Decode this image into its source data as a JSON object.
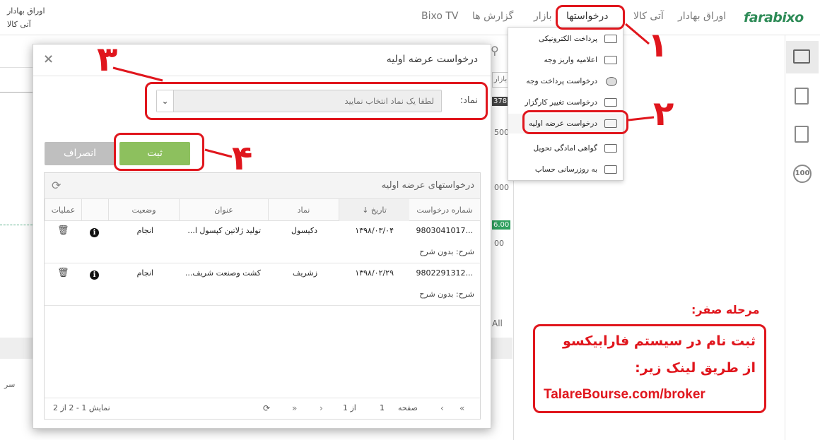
{
  "header": {
    "logo_text": "farabixo",
    "nav": [
      "اوراق بهادار",
      "آتی کالا",
      "درخواستها",
      "بازار",
      "گزارش ها",
      "Bixo TV"
    ],
    "top_left_line1": "اوراق بهادار",
    "top_left_line2": "آتی کالا"
  },
  "menu": {
    "items": [
      {
        "label": "پرداخت الکترونیکی",
        "icon": "card-icon"
      },
      {
        "label": "اعلامیه واریز وجه",
        "icon": "receipt-icon"
      },
      {
        "label": "درخواست پرداخت وجه",
        "icon": "coins-icon"
      },
      {
        "label": "درخواست تغییر کارگزار ناظر",
        "icon": "form-icon"
      },
      {
        "label": "درخواست عرضه اولیه",
        "icon": "form-icon"
      },
      {
        "label": "گواهی امادگی تحویل",
        "icon": "sign-icon"
      },
      {
        "label": "به روزرسانی حساب",
        "icon": "sign-icon"
      }
    ]
  },
  "background": {
    "cell1": "بازار",
    "val1": "378.0",
    "val2": "500",
    "val3": "000",
    "val4": "6.00",
    "val5": "00",
    "val6": "All",
    "col_hint": "سر"
  },
  "modal": {
    "title": "درخواست عرضه اولیه",
    "close": "×",
    "field_label": "نماد:",
    "select_placeholder": "لطفا یک نماد انتخاب نمایید",
    "save_label": "ثبت",
    "cancel_label": "انصراف",
    "grid_title": "درخواستهای عرضه اولیه",
    "columns": [
      "شماره درخواست",
      "تاریخ",
      "نماد",
      "عنوان",
      "وضعیت",
      "",
      "عملیات"
    ],
    "rows": [
      {
        "number": "9803041017...",
        "date": "۱۳۹۸/۰۳/۰۴",
        "symbol": "دکیسول",
        "title": "تولید ژلاتین کپسول ا...",
        "status": "انجام",
        "desc": "شرح: بدون شرح"
      },
      {
        "number": "9802291312...",
        "date": "۱۳۹۸/۰۲/۲۹",
        "symbol": "زشریف",
        "title": "کشت وصنعت شریف...",
        "status": "انجام",
        "desc": "شرح: بدون شرح"
      }
    ],
    "pager": {
      "page_label": "صفحه",
      "page_value": "1",
      "of_label": "از 1",
      "summary": "نمایش 1 - 2 از 2"
    }
  },
  "annotations": {
    "n1": "١",
    "n2": "٢",
    "n3": "٣",
    "n4": "۴",
    "stage_title": "مرحله صفر:",
    "promo_line1": "ثبت نام در سیستم فارابیکسو",
    "promo_line2": "از طریق لینک زیر:",
    "promo_line3": "TalareBourse.com/broker"
  },
  "colors": {
    "accent_red": "#e0161d",
    "save_green": "#8dc05e",
    "brand_green": "#2e8b57"
  }
}
